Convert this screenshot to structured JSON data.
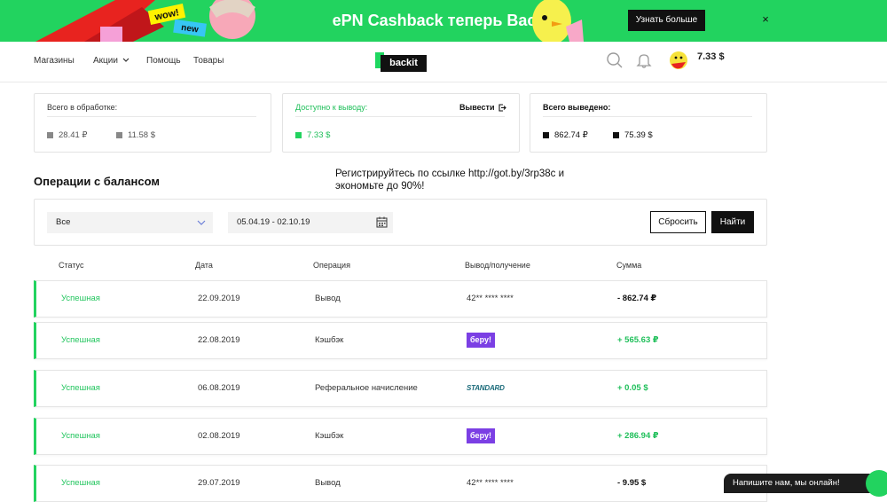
{
  "banner": {
    "title": "ePN Cashback теперь Backit",
    "button": "Узнать больше",
    "close": "×",
    "sticker1": "wow!",
    "sticker2": "new"
  },
  "header": {
    "nav": [
      "Магазины",
      "Акции",
      "Помощь",
      "Товары"
    ],
    "logo": "backit",
    "balance": "7.33 $"
  },
  "cards": {
    "processing": {
      "title": "Всего в обработке:",
      "rub": "28.41 ₽",
      "usd": "11.58 $"
    },
    "available": {
      "title": "Доступно к выводу:",
      "action": "Вывести",
      "usd": "7.33 $"
    },
    "withdrawn": {
      "title": "Всего выведено:",
      "rub": "862.74 ₽",
      "usd": "75.39 $"
    }
  },
  "ops_title": "Операции с балансом",
  "promo": "Регистрируйтесь по ссылке http://got.by/3rp38c и экономьте до 90%!",
  "filters": {
    "type_value": "Все",
    "date_range": "05.04.19 - 02.10.19",
    "reset": "Сбросить",
    "find": "Найти"
  },
  "table": {
    "headers": [
      "Статус",
      "Дата",
      "Операция",
      "Вывод/получение",
      "Сумма"
    ],
    "rows": [
      {
        "status": "Успешная",
        "date": "22.09.2019",
        "operation": "Вывод",
        "method": "42** **** ****",
        "method_type": "card",
        "amount": "- 862.74 ₽",
        "sign": "neg"
      },
      {
        "status": "Успешная",
        "date": "22.08.2019",
        "operation": "Кэшбэк",
        "method": "беру!",
        "method_type": "beru",
        "amount": "+ 565.63 ₽",
        "sign": "pos"
      },
      {
        "status": "Успешная",
        "date": "06.08.2019",
        "operation": "Реферальное начисление",
        "method": "STANDARD",
        "method_type": "standard",
        "amount": "+ 0.05 $",
        "sign": "pos"
      },
      {
        "status": "Успешная",
        "date": "02.08.2019",
        "operation": "Кэшбэк",
        "method": "беру!",
        "method_type": "beru",
        "amount": "+ 286.94 ₽",
        "sign": "pos"
      },
      {
        "status": "Успешная",
        "date": "29.07.2019",
        "operation": "Вывод",
        "method": "42** **** ****",
        "method_type": "card",
        "amount": "- 9.95 $",
        "sign": "neg"
      }
    ]
  },
  "chat": "Напишите нам, мы онлайн!"
}
